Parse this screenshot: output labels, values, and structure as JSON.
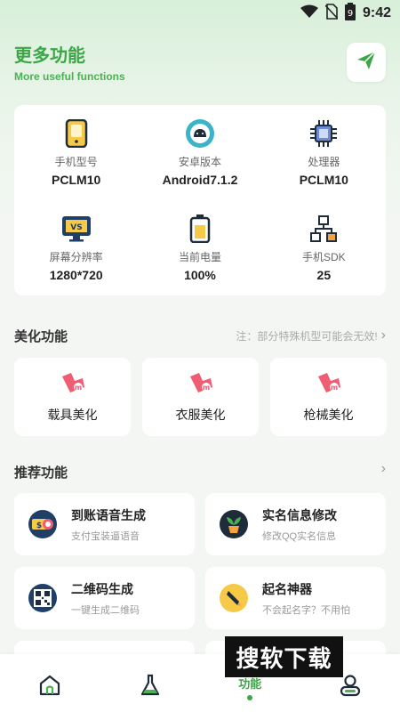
{
  "status_bar": {
    "time": "9:42",
    "battery_level": "9"
  },
  "header": {
    "title": "更多功能",
    "subtitle": "More useful functions",
    "accent_color": "#3da647"
  },
  "device_info": [
    {
      "label": "手机型号",
      "value": "PCLM10",
      "icon": "phone-icon"
    },
    {
      "label": "安卓版本",
      "value": "Android7.1.2",
      "icon": "android-icon"
    },
    {
      "label": "处理器",
      "value": "PCLM10",
      "icon": "chip-icon"
    },
    {
      "label": "屏幕分辨率",
      "value": "1280*720",
      "icon": "monitor-icon"
    },
    {
      "label": "当前电量",
      "value": "100%",
      "icon": "battery-icon"
    },
    {
      "label": "手机SDK",
      "value": "25",
      "icon": "network-icon"
    }
  ],
  "beauty_section": {
    "title": "美化功能",
    "note": "注：部分特殊机型可能会无效!",
    "items": [
      {
        "label": "载具美化",
        "icon": "beauty-icon"
      },
      {
        "label": "衣服美化",
        "icon": "beauty-icon"
      },
      {
        "label": "枪械美化",
        "icon": "beauty-icon"
      }
    ]
  },
  "recommend_section": {
    "title": "推荐功能",
    "items": [
      {
        "title": "到账语音生成",
        "subtitle": "支付宝装逼语音",
        "icon": "voice-icon"
      },
      {
        "title": "实名信息修改",
        "subtitle": "修改QQ实名信息",
        "icon": "plant-icon"
      },
      {
        "title": "二维码生成",
        "subtitle": "一键生成二维码",
        "icon": "qrcode-icon"
      },
      {
        "title": "起名神器",
        "subtitle": "不会起名字？不用怕",
        "icon": "pen-icon"
      }
    ]
  },
  "bottom_nav": {
    "items": [
      {
        "label": "",
        "icon": "home-icon"
      },
      {
        "label": "",
        "icon": "flask-icon"
      },
      {
        "label": "功能",
        "icon": ""
      },
      {
        "label": "",
        "icon": "user-icon"
      }
    ]
  },
  "watermark": "搜软下载"
}
